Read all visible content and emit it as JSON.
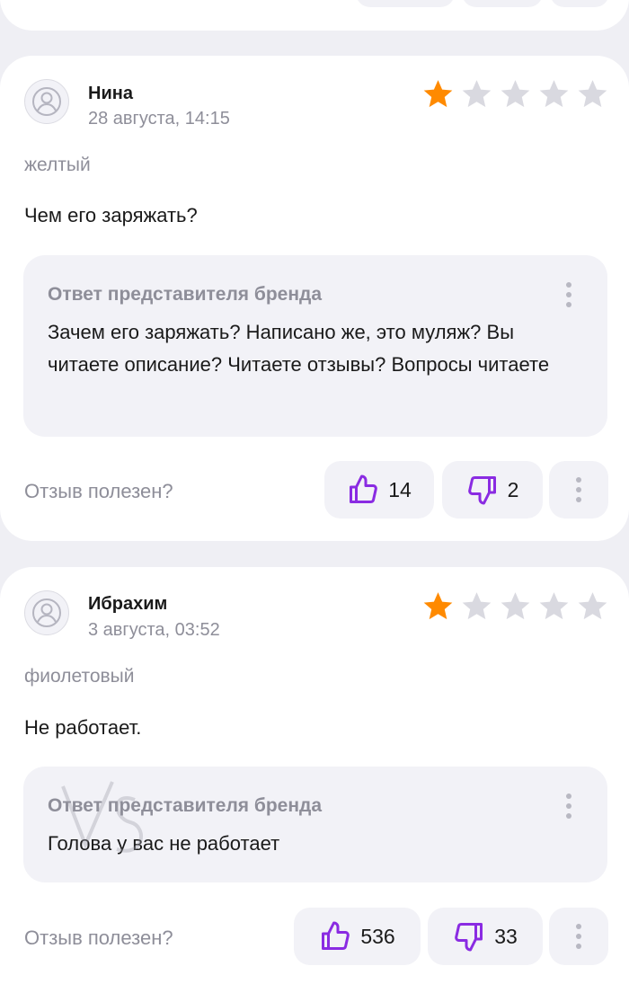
{
  "colors": {
    "accent": "#8a2be2",
    "star_filled": "#ff8a00",
    "star_empty": "#d9d9e0",
    "muted_text": "#8e8e99",
    "card_bg": "#ffffff",
    "page_bg": "#efeff4",
    "reply_bg": "#f2f2f7"
  },
  "icons": {
    "avatar": "user-circle-icon",
    "star": "star-icon",
    "like": "thumbs-up-icon",
    "dislike": "thumbs-down-icon",
    "more": "more-vertical-icon"
  },
  "reviews": [
    {
      "author": "Нина",
      "date": "28 августа, 14:15",
      "rating": 1,
      "max_rating": 5,
      "variant": "желтый",
      "text": "Чем его заряжать?",
      "brand_reply": {
        "title": "Ответ представителя бренда",
        "text": "Зачем его заряжать? Написано же, это муляж? Вы читаете описание? Читаете отзывы? Вопросы читаете"
      },
      "helpful_label": "Отзыв полезен?",
      "likes": "14",
      "dislikes": "2"
    },
    {
      "author": "Ибрахим",
      "date": "3 августа, 03:52",
      "rating": 1,
      "max_rating": 5,
      "variant": "фиолетовый",
      "text": "Не работает.",
      "brand_reply": {
        "title": "Ответ представителя бренда",
        "text": "Голова у вас не работает"
      },
      "helpful_label": "Отзыв полезен?",
      "likes": "536",
      "dislikes": "33"
    }
  ]
}
